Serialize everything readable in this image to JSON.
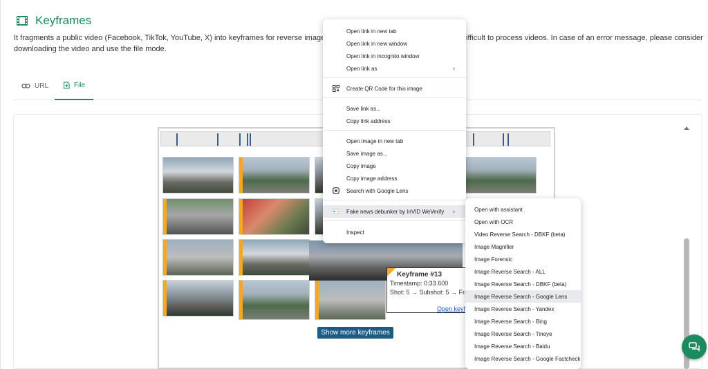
{
  "header": {
    "title": "Keyframes",
    "description_part1": "It fragments a public video (Facebook, TikTok, YouTube, X) into keyframes for reverse image sea",
    "description_part2": "ifficult to process videos. In case of an error message, please consider",
    "description_line2": "downloading the video and use the file mode."
  },
  "tabs": [
    {
      "label": "URL",
      "icon": "link-icon",
      "active": false
    },
    {
      "label": "File",
      "icon": "file-upload-icon",
      "active": true
    }
  ],
  "tooltip": {
    "title": "Keyframe #13",
    "timestamp": "Timestamp: 0:33.600",
    "shot": "Shot: 5 → Subshot: 5 → Fran",
    "open_link": "Open keyf"
  },
  "show_more_label": "Show more keyframes",
  "context_menu": {
    "items": [
      {
        "label": "Open link in new tab"
      },
      {
        "label": "Open link in new window"
      },
      {
        "label": "Open link in incognito window"
      },
      {
        "label": "Open link as"
      },
      {
        "label": "Create QR Code for this image"
      },
      {
        "label": "Save link as..."
      },
      {
        "label": "Copy link address"
      },
      {
        "label": "Open image in new tab"
      },
      {
        "label": "Save image as..."
      },
      {
        "label": "Copy image"
      },
      {
        "label": "Copy image address"
      },
      {
        "label": "Search with Google Lens"
      },
      {
        "label": "Fake news debunker by InVID  WeVerify"
      },
      {
        "label": "Inspect"
      }
    ]
  },
  "submenu": {
    "items": [
      {
        "label": "Open with assistant"
      },
      {
        "label": "Open with OCR"
      },
      {
        "label": "Video Reverse Search - DBKF (beta)"
      },
      {
        "label": "Image Magnifier"
      },
      {
        "label": "Image Forensic"
      },
      {
        "label": "Image Reverse Search - ALL"
      },
      {
        "label": "Image Reverse Search - DBKF (beta)"
      },
      {
        "label": "Image Reverse Search - Google Lens"
      },
      {
        "label": "Image Reverse Search - Yandex"
      },
      {
        "label": "Image Reverse Search - Bing"
      },
      {
        "label": "Image Reverse Search - Tineye"
      },
      {
        "label": "Image Reverse Search - Baidu"
      },
      {
        "label": "Image Reverse Search - Google Factcheck"
      }
    ]
  },
  "colors": {
    "accent": "#1c8b5f",
    "keyframe_marker": "#f5a623",
    "button": "#1b5c86"
  }
}
